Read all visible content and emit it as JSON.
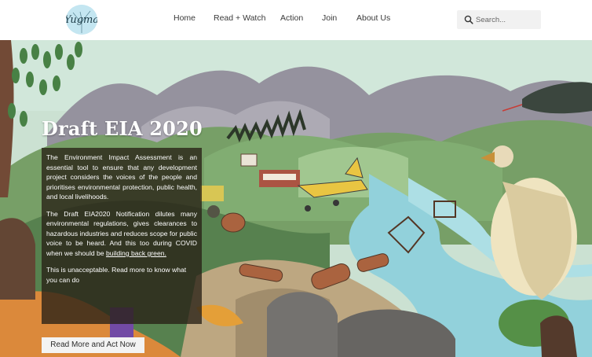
{
  "brand": {
    "logo_text": "Yugma"
  },
  "nav": {
    "items": [
      {
        "label": "Home"
      },
      {
        "label": "Read + Watch"
      },
      {
        "label": "Action"
      },
      {
        "label": "Join"
      },
      {
        "label": "About Us"
      }
    ]
  },
  "search": {
    "placeholder": "Search..."
  },
  "hero": {
    "title": "Draft EIA 2020",
    "paragraph_1": "The Environment Impact Assessment is an essential tool to ensure that any development project considers the voices of the people and prioritises environmental protection, public health, and local livelihoods.",
    "paragraph_2_text": "The Draft EIA2020 Notification dilutes many environmental regulations, gives clearances to hazardous industries and reduces scope for public voice to be heard. And this too during COVID when we should be ",
    "paragraph_2_link": "building back green.",
    "paragraph_3": "This is unacceptable. Read more to know what you can do",
    "cta_label": "Read More and Act Now"
  },
  "colors": {
    "header_bg": "#ffffff",
    "card_bg": "#2a2016",
    "cta_bg": "#f3f3f3"
  }
}
